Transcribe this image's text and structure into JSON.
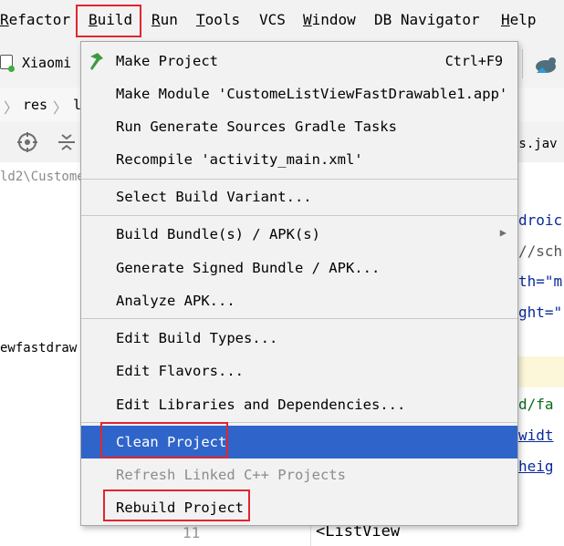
{
  "menubar": {
    "items": [
      "Refactor",
      "Build",
      "Run",
      "Tools",
      "VCS",
      "Window",
      "DB Navigator",
      "Help"
    ]
  },
  "toolbar": {
    "device": "Xiaomi"
  },
  "breadcrumb": {
    "res": "res",
    "next": "l"
  },
  "left_panel": {
    "path": "ld2\\Custome",
    "text": "ewfastdraw"
  },
  "editor": {
    "tab": "es.jav",
    "lines": [
      "droic",
      "//sch",
      "th=\"m",
      "ght=\"",
      "",
      "d/fa",
      "widt",
      "heig"
    ],
    "line_number": "11",
    "listview": "<ListView"
  },
  "build_menu": {
    "groups": [
      [
        {
          "label": "Make Project",
          "shortcut": "Ctrl+F9",
          "icon": "hammer-icon"
        },
        {
          "label": "Make Module 'CustomeListViewFastDrawable1.app'"
        },
        {
          "label": "Run Generate Sources Gradle Tasks"
        },
        {
          "label": "Recompile 'activity_main.xml'"
        }
      ],
      [
        {
          "label": "Select Build Variant..."
        }
      ],
      [
        {
          "label": "Build Bundle(s) / APK(s)",
          "submenu": true
        },
        {
          "label": "Generate Signed Bundle / APK..."
        },
        {
          "label": "Analyze APK..."
        }
      ],
      [
        {
          "label": "Edit Build Types..."
        },
        {
          "label": "Edit Flavors..."
        },
        {
          "label": "Edit Libraries and Dependencies..."
        }
      ],
      [
        {
          "label": "Clean Project",
          "highlighted": true
        },
        {
          "label": "Refresh Linked C++ Projects",
          "disabled": true
        },
        {
          "label": "Rebuild Project"
        }
      ]
    ]
  },
  "colors": {
    "highlight": "#2f65ca",
    "annotation": "#e0262f",
    "menu_bg": "#f2f2f2"
  }
}
